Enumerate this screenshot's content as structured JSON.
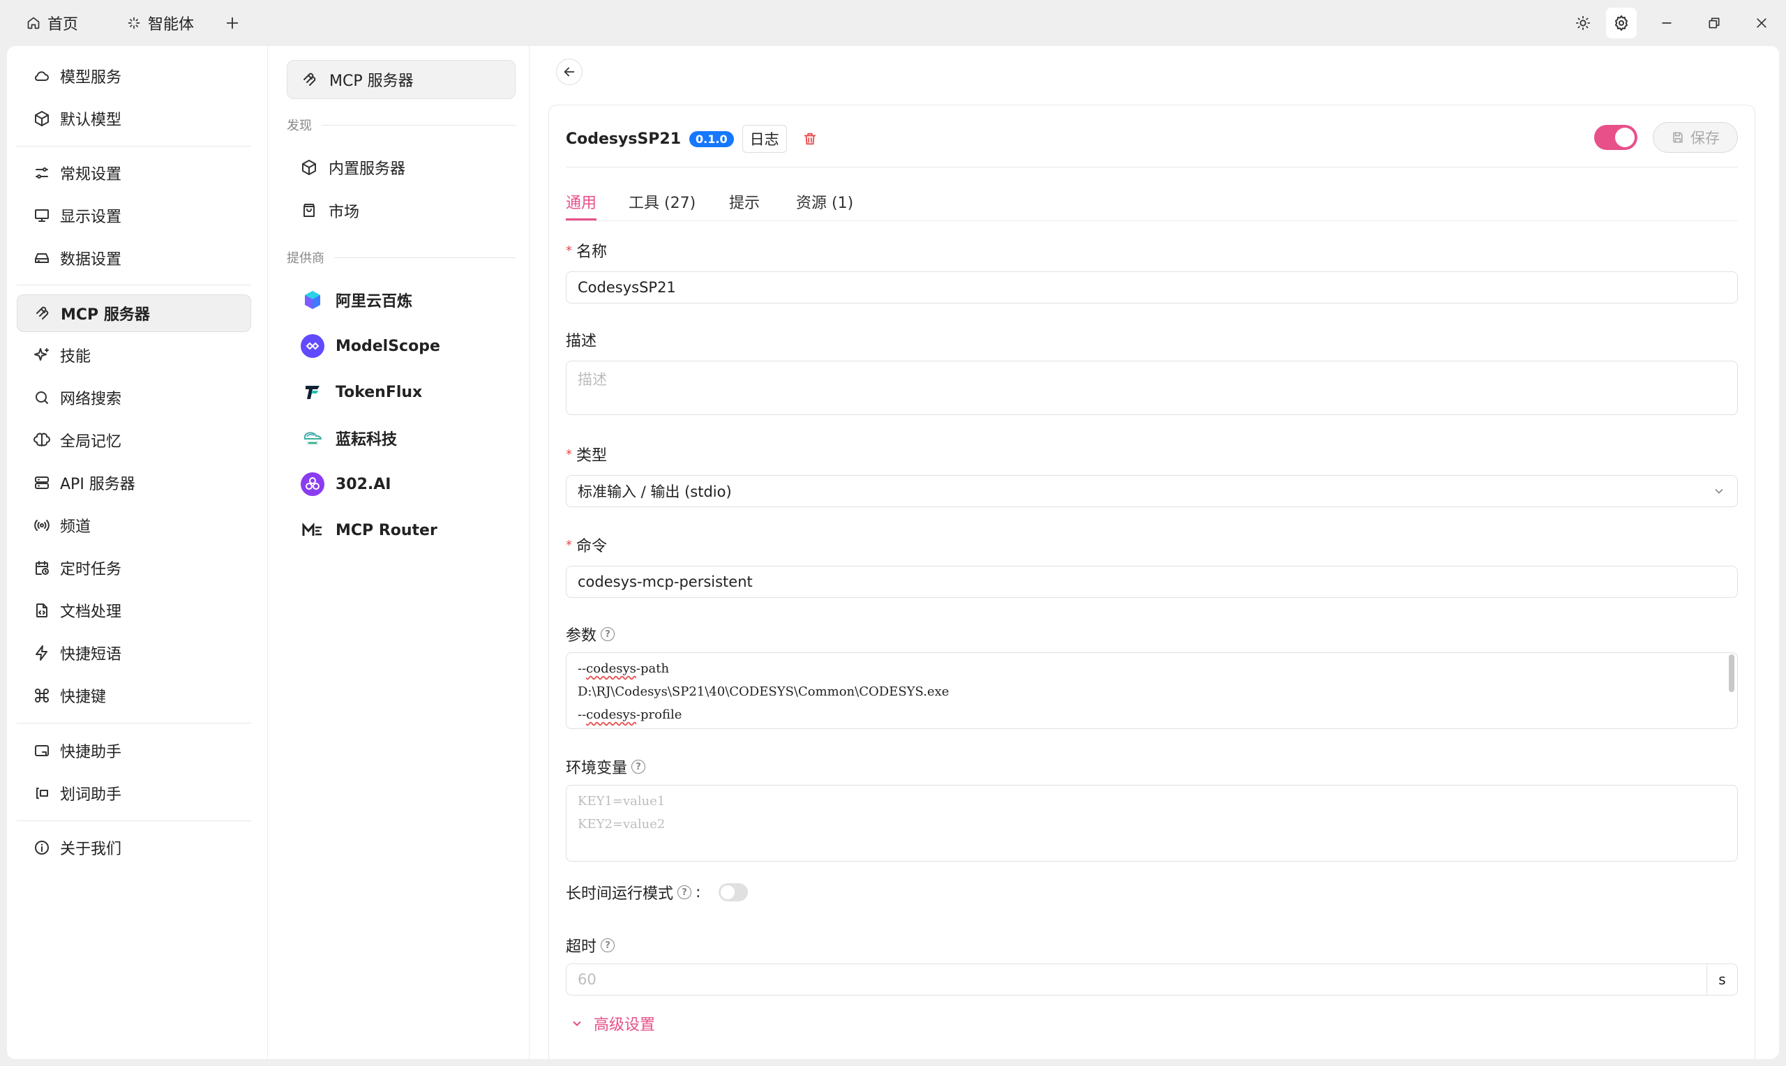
{
  "titlebar": {
    "tabs": [
      {
        "label": "首页",
        "icon": "home-icon"
      },
      {
        "label": "智能体",
        "icon": "sparkle-icon"
      }
    ],
    "add_icon": "plus-icon",
    "controls": [
      "sun-icon",
      "gear-icon",
      "minimize-icon",
      "restore-icon",
      "close-icon"
    ]
  },
  "nav": {
    "items": [
      {
        "label": "模型服务",
        "icon": "cloud-icon"
      },
      {
        "label": "默认模型",
        "icon": "cube-icon"
      },
      {
        "label": "常规设置",
        "icon": "sliders-icon"
      },
      {
        "label": "显示设置",
        "icon": "monitor-icon"
      },
      {
        "label": "数据设置",
        "icon": "hard-drive-icon"
      },
      {
        "label": "MCP 服务器",
        "icon": "mcp-icon",
        "active": true
      },
      {
        "label": "技能",
        "icon": "sparkles-icon"
      },
      {
        "label": "网络搜索",
        "icon": "search-icon"
      },
      {
        "label": "全局记忆",
        "icon": "brain-icon"
      },
      {
        "label": "API 服务器",
        "icon": "server-icon"
      },
      {
        "label": "频道",
        "icon": "radio-icon"
      },
      {
        "label": "定时任务",
        "icon": "calendar-clock-icon"
      },
      {
        "label": "文档处理",
        "icon": "file-code-icon"
      },
      {
        "label": "快捷短语",
        "icon": "zap-icon"
      },
      {
        "label": "快捷键",
        "icon": "command-icon"
      },
      {
        "label": "快捷助手",
        "icon": "app-window-icon"
      },
      {
        "label": "划词助手",
        "icon": "text-select-icon"
      },
      {
        "label": "关于我们",
        "icon": "info-icon"
      }
    ]
  },
  "sub": {
    "top": {
      "label": "MCP 服务器",
      "icon": "mcp-icon"
    },
    "discover_title": "发现",
    "discover": [
      {
        "label": "内置服务器",
        "icon": "cube-icon"
      },
      {
        "label": "市场",
        "icon": "shopping-bag-icon"
      }
    ],
    "providers_title": "提供商",
    "providers": [
      {
        "label": "阿里云百炼",
        "icon": "bailian-logo-icon"
      },
      {
        "label": "ModelScope",
        "icon": "modelscope-logo-icon"
      },
      {
        "label": "TokenFlux",
        "icon": "tokenflux-logo-icon"
      },
      {
        "label": "蓝耘科技",
        "icon": "lanyun-logo-icon"
      },
      {
        "label": "302.AI",
        "icon": "302ai-logo-icon"
      },
      {
        "label": "MCP Router",
        "icon": "mcprouter-logo-icon"
      }
    ]
  },
  "server": {
    "name": "CodesysSP21",
    "version": "0.1.0",
    "log_label": "日志",
    "save_label": "保存",
    "enabled": true
  },
  "tabs": [
    {
      "label": "通用",
      "active": true
    },
    {
      "label": "工具 (27)"
    },
    {
      "label": "提示"
    },
    {
      "label": "资源 (1)"
    }
  ],
  "form": {
    "name_label": "名称",
    "name_value": "CodesysSP21",
    "desc_label": "描述",
    "desc_placeholder": "描述",
    "type_label": "类型",
    "type_value": "标准输入 / 输出 (stdio)",
    "command_label": "命令",
    "command_value": "codesys-mcp-persistent",
    "args_label": "参数",
    "args_lines": [
      {
        "pre": "--",
        "word": "codesys",
        "post": "-path"
      },
      {
        "pre": "D:\\RJ\\Codesys\\SP21\\40\\CODESYS\\Common\\CODESYS.exe",
        "word": "",
        "post": ""
      },
      {
        "pre": "--",
        "word": "codesys",
        "post": "-profile"
      }
    ],
    "env_label": "环境变量",
    "env_placeholder": [
      "KEY1=value1",
      "KEY2=value2"
    ],
    "longrun_label": "长时间运行模式",
    "longrun_colon": ":",
    "longrun_enabled": false,
    "timeout_label": "超时",
    "timeout_placeholder": "60",
    "timeout_unit": "s",
    "advanced_label": "高级设置"
  },
  "colors": {
    "accent": "#e8508a",
    "version_badge": "#1677ff",
    "required": "#e84a4a"
  }
}
